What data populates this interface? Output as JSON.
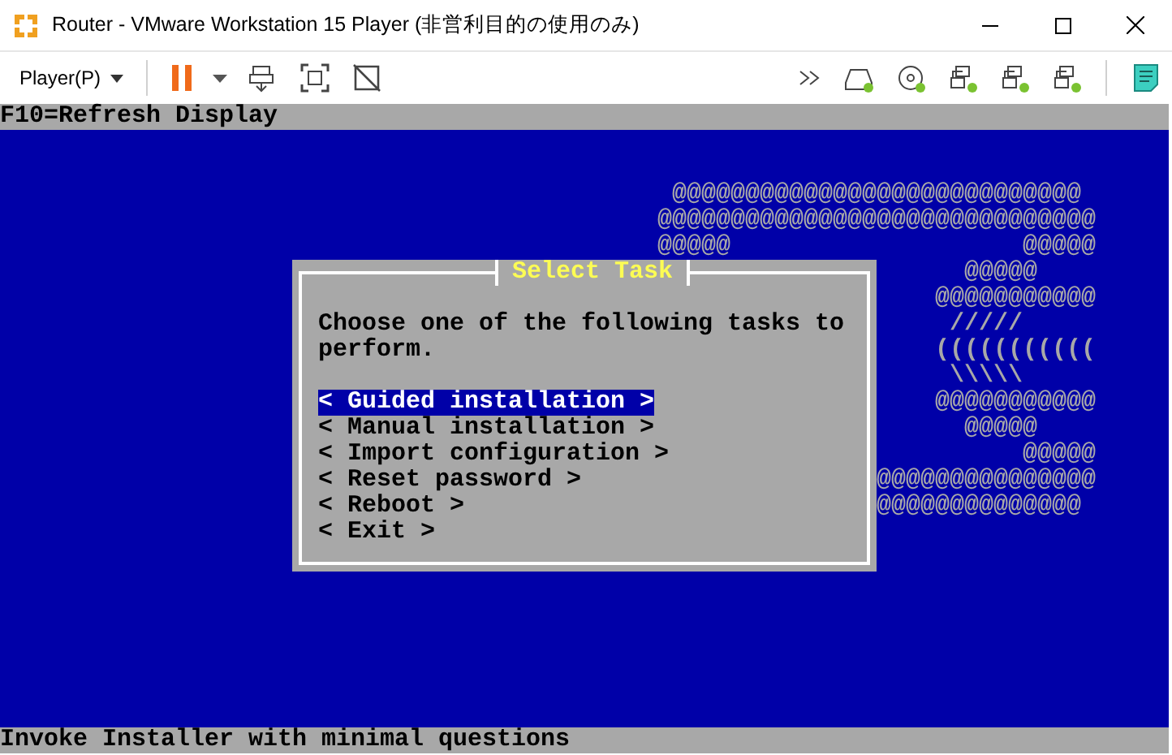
{
  "window": {
    "title": "Router - VMware Workstation 15 Player (非営利目的の使用のみ)"
  },
  "toolbar": {
    "player_menu": "Player(P)"
  },
  "console": {
    "top_bar": "F10=Refresh Display",
    "art_lines": [
      "@@@@@@@@@@@@@@@@@@@@@@@@@@@@",
      "@@@@@@@@@@@@@@@@@@@@@@@@@@@@@@",
      "@@@@@",
      "@@@@@",
      "@@@@@",
      "@@@@@@@@@@@",
      "/////",
      "(((((((((((",
      "\\\\\\\\\\",
      "@@@@@@@@@@@",
      "@@@@@",
      "@@@@@",
      "@@@@@@@@@@@@@@@",
      "@@@@@@@@@@@@@@"
    ],
    "dialog": {
      "title": "Select Task",
      "prompt": "Choose one of the following tasks to perform.",
      "items": [
        {
          "label": "< Guided installation >",
          "selected": true
        },
        {
          "label": "< Manual installation >",
          "selected": false
        },
        {
          "label": "< Import configuration >",
          "selected": false
        },
        {
          "label": "< Reset password >",
          "selected": false
        },
        {
          "label": "< Reboot >",
          "selected": false
        },
        {
          "label": "< Exit >",
          "selected": false
        }
      ]
    },
    "status_line": "Invoke Installer with minimal questions"
  }
}
